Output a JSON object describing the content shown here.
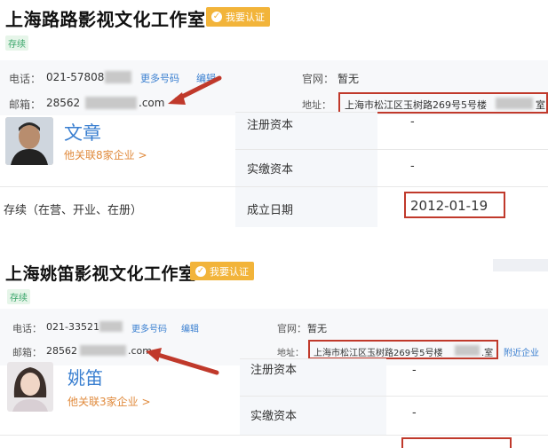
{
  "panels": [
    {
      "company_name": "上海路路影视文化工作室",
      "verify_badge": "我要认证",
      "status_tag": "存续",
      "phone_label": "电话：",
      "phone_value": "021-57808",
      "more_numbers": "更多号码",
      "edit": "编辑",
      "website_label": "官网：",
      "website_value": "暂无",
      "email_label": "邮箱：",
      "email_prefix": "28562",
      "email_suffix": ".com",
      "address_label": "地址：",
      "address_value": "上海市松江区玉树路269号5号楼",
      "address_tail": "室",
      "person_name": "文章",
      "person_link": "他关联8家企业 >",
      "registered_capital_label": "注册资本",
      "registered_capital_value": "-",
      "paid_capital_label": "实缴资本",
      "paid_capital_value": "-",
      "status_full": "存续（在营、开业、在册）",
      "established_label": "成立日期",
      "established_value": "2012-01-19"
    },
    {
      "company_name": "上海姚笛影视文化工作室",
      "verify_badge": "我要认证",
      "status_tag": "存续",
      "phone_label": "电话：",
      "phone_value": "021-33521",
      "more_numbers": "更多号码",
      "edit": "编辑",
      "website_label": "官网：",
      "website_value": "暂无",
      "email_label": "邮箱：",
      "email_prefix": "28562",
      "email_suffix": ".com",
      "address_label": "地址：",
      "address_value": "上海市松江区玉树路269号5号楼",
      "address_tail": ".室",
      "nearby": "附近企业",
      "person_name": "姚笛",
      "person_link": "他关联3家企业 >",
      "registered_capital_label": "注册资本",
      "registered_capital_value": "-",
      "paid_capital_label": "实缴资本",
      "paid_capital_value": "-"
    }
  ],
  "colors": {
    "highlight": "#c0392b",
    "link": "#3a7fd0",
    "badge": "#f2b43a",
    "status": "#3aa66a"
  }
}
